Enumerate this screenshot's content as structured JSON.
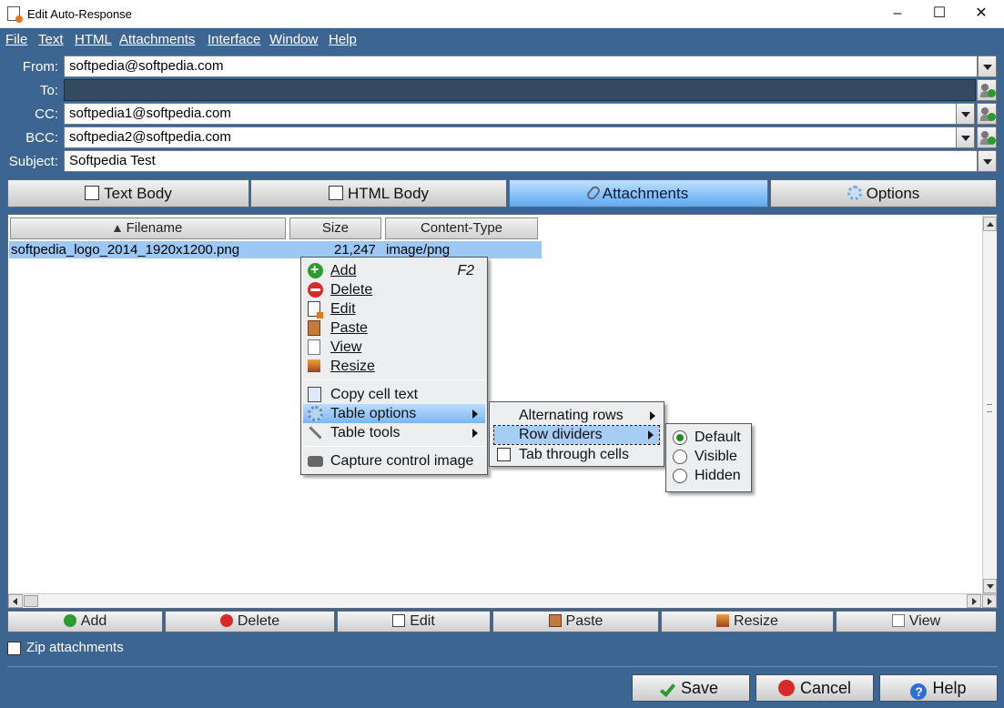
{
  "window": {
    "title": "Edit Auto-Response"
  },
  "menubar": [
    "File",
    "Text",
    "HTML",
    "Attachments",
    "Interface",
    "Window",
    "Help"
  ],
  "fields": {
    "from": {
      "label": "From:",
      "value": "softpedia@softpedia.com"
    },
    "to": {
      "label": "To:",
      "value": ""
    },
    "cc": {
      "label": "CC:",
      "value": "softpedia1@softpedia.com"
    },
    "bcc": {
      "label": "BCC:",
      "value": "softpedia2@softpedia.com"
    },
    "subject": {
      "label": "Subject:",
      "value": "Softpedia Test"
    }
  },
  "tabs": [
    {
      "label": "Text Body",
      "icon": "text-body-icon"
    },
    {
      "label": "HTML Body",
      "icon": "html-body-icon"
    },
    {
      "label": "Attachments",
      "icon": "paperclip-icon",
      "active": true
    },
    {
      "label": "Options",
      "icon": "gear-icon"
    }
  ],
  "table": {
    "columns": [
      "Filename",
      "Size",
      "Content-Type"
    ],
    "rows": [
      {
        "filename": "softpedia_logo_2014_1920x1200.png",
        "size": "21,247",
        "type": "image/png"
      }
    ]
  },
  "context_menu": {
    "items": [
      {
        "label": "Add",
        "shortcut": "F2",
        "icon": "add-icon"
      },
      {
        "label": "Delete",
        "icon": "delete-icon"
      },
      {
        "label": "Edit",
        "icon": "edit-icon"
      },
      {
        "label": "Paste",
        "icon": "paste-icon"
      },
      {
        "label": "View",
        "icon": "view-icon"
      },
      {
        "label": "Resize",
        "icon": "resize-icon"
      },
      {
        "label": "Copy cell text",
        "icon": "copy-icon"
      },
      {
        "label": "Table options",
        "icon": "gear-icon",
        "highlighted": true
      },
      {
        "label": "Table tools",
        "icon": "tools-icon"
      },
      {
        "label": "Capture control image",
        "icon": "camera-icon"
      }
    ]
  },
  "submenu": {
    "items": [
      "Alternating rows",
      "Row dividers",
      "Tab through cells"
    ]
  },
  "radio_menu": {
    "items": [
      "Default",
      "Visible",
      "Hidden"
    ],
    "selected": "Default"
  },
  "toolbar": [
    "Add",
    "Delete",
    "Edit",
    "Paste",
    "Resize",
    "View"
  ],
  "zip": {
    "label": "Zip attachments",
    "checked": false
  },
  "buttons": {
    "save": "Save",
    "cancel": "Cancel",
    "help": "Help"
  }
}
